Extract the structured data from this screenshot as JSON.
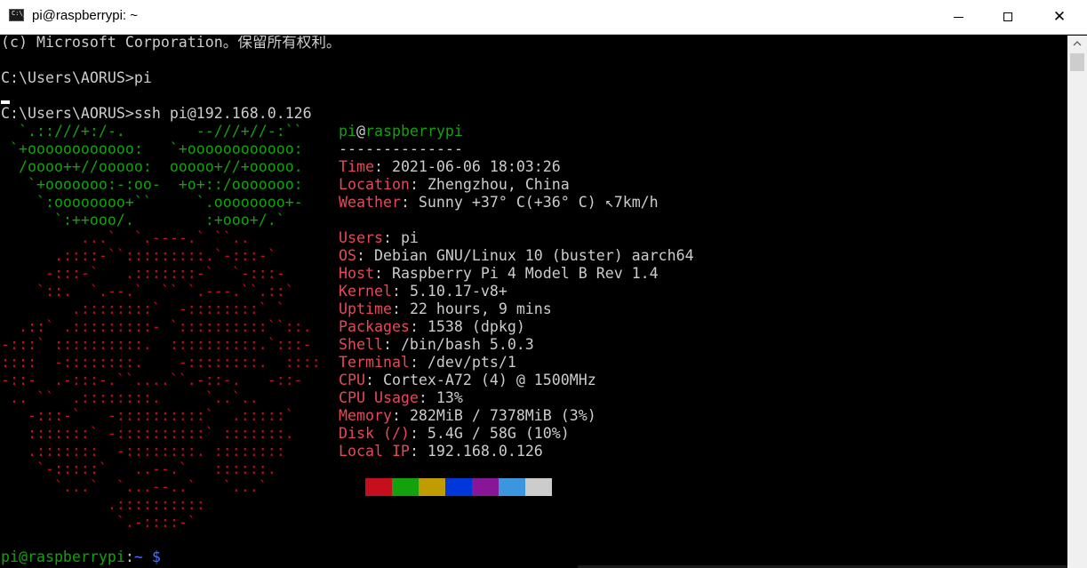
{
  "window": {
    "title": "pi@raspberrypi: ~",
    "icon": "console-icon",
    "icon_text": "C:\\_",
    "minimize_icon": "minimize-icon",
    "maximize_icon": "maximize-icon",
    "close_icon": "close-icon",
    "close_glyph": "✕"
  },
  "terminal": {
    "copyright": "(c) Microsoft Corporation。保留所有权利。",
    "cmd1": "C:\\Users\\AORUS>pi",
    "cmd2": "C:\\Users\\AORUS>ssh pi@192.168.0.126",
    "user_host": {
      "user": "pi",
      "at": "@",
      "host": "raspberrypi"
    },
    "separator": "--------------",
    "info": [
      {
        "key": "Time",
        "value": "2021-06-06 18:03:26"
      },
      {
        "key": "Location",
        "value": "Zhengzhou, China"
      },
      {
        "key": "Weather",
        "value": "Sunny +37° C(+36° C) ↖7km/h"
      },
      {
        "key": "Users",
        "value": "pi"
      },
      {
        "key": "OS",
        "value": "Debian GNU/Linux 10 (buster) aarch64"
      },
      {
        "key": "Host",
        "value": "Raspberry Pi 4 Model B Rev 1.4"
      },
      {
        "key": "Kernel",
        "value": "5.10.17-v8+"
      },
      {
        "key": "Uptime",
        "value": "22 hours, 9 mins"
      },
      {
        "key": "Packages",
        "value": "1538 (dpkg)"
      },
      {
        "key": "Shell",
        "value": "/bin/bash 5.0.3"
      },
      {
        "key": "Terminal",
        "value": "/dev/pts/1"
      },
      {
        "key": "CPU",
        "value": "Cortex-A72 (4) @ 1500MHz"
      },
      {
        "key": "CPU Usage",
        "value": "13%"
      },
      {
        "key": "Memory",
        "value": "282MiB / 7378MiB (3%)"
      },
      {
        "key": "Disk (/)",
        "value": "5.4G / 58G (10%)"
      },
      {
        "key": "Local IP",
        "value": "192.168.0.126"
      }
    ],
    "palette": [
      "#c50f1f",
      "#13a10e",
      "#c19c00",
      "#0037da",
      "#881798",
      "#3a96dd",
      "#cccccc"
    ],
    "prompt": {
      "user_host": "pi@raspberrypi",
      "colon": ":",
      "path": "~",
      "dollar": "$"
    },
    "logo_leaves": [
      "  `.::///+:/-.        --///+//-:``",
      " `+oooooooooooo:   `+oooooooooooo:",
      "  /oooo++//ooooo:  ooooo+//+ooooo.",
      "   `+ooooooo:-:oo-  +o+::/ooooooo:",
      "    `:oooooooo+``     `.oooooooo+-",
      "      `:++ooo/.        :+ooo+/.`"
    ],
    "logo_berry": [
      "         ...`  `.----.` ``..",
      "      .::::-``:::::::::.`-:::-`",
      "     -:::-`   .:::::::-`  `-:::-",
      "    `::.  `.--.`  `` `.---.``.::`",
      "        .::::::::`  -::::::::` `",
      "  .::` .:::::::::- `::::::::::``::.",
      "-:::` ::::::::::.  ::::::::::.`:::-",
      "::::  -::::::::.    -::::::::.  ::::",
      "-::-  .-:::-.``....``.-::-.   -::-",
      " .. ``  .::::::::.     `..`..",
      "   -:::-`   -::::::::::`  .:::::`",
      "   :::::::` -::::::::::` :::::::.",
      "   .:::::::  -::::::::. ::::::::",
      "    `-:::::`   ..--.`   ::::::.",
      "      `...`  `...--..`   `...`",
      "            .::::::::::",
      "             `.-::::-`"
    ]
  }
}
